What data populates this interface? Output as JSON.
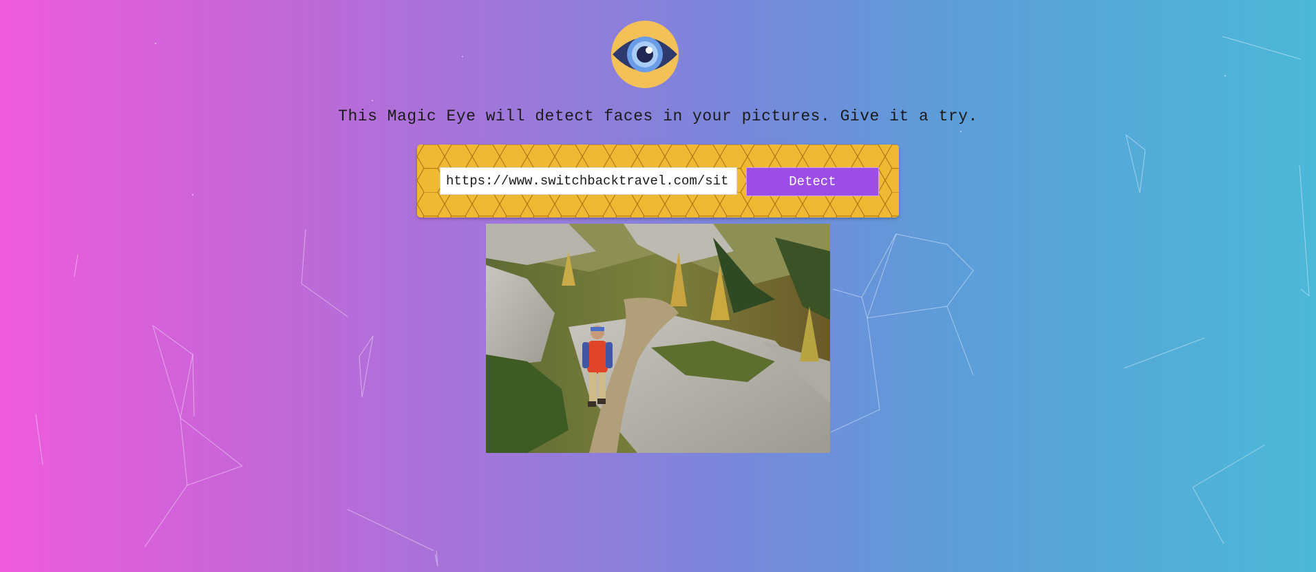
{
  "header": {
    "logo_icon": "eye-icon",
    "tagline": "This Magic Eye will detect faces in your pictures. Give it a try."
  },
  "search": {
    "url_value": "https://www.switchbacktravel.com/sit",
    "detect_label": "Detect"
  },
  "colors": {
    "gradient_left": "#ef5bdc",
    "gradient_right": "#4bb8d8",
    "panel": "#f1b833",
    "button": "#9b4de6",
    "logo_disc": "#f4c158",
    "eye_dark": "#2e3a6e",
    "eye_iris": "#6a9de6"
  },
  "image": {
    "subject": "hiker-on-rocky-mountain-trail"
  }
}
